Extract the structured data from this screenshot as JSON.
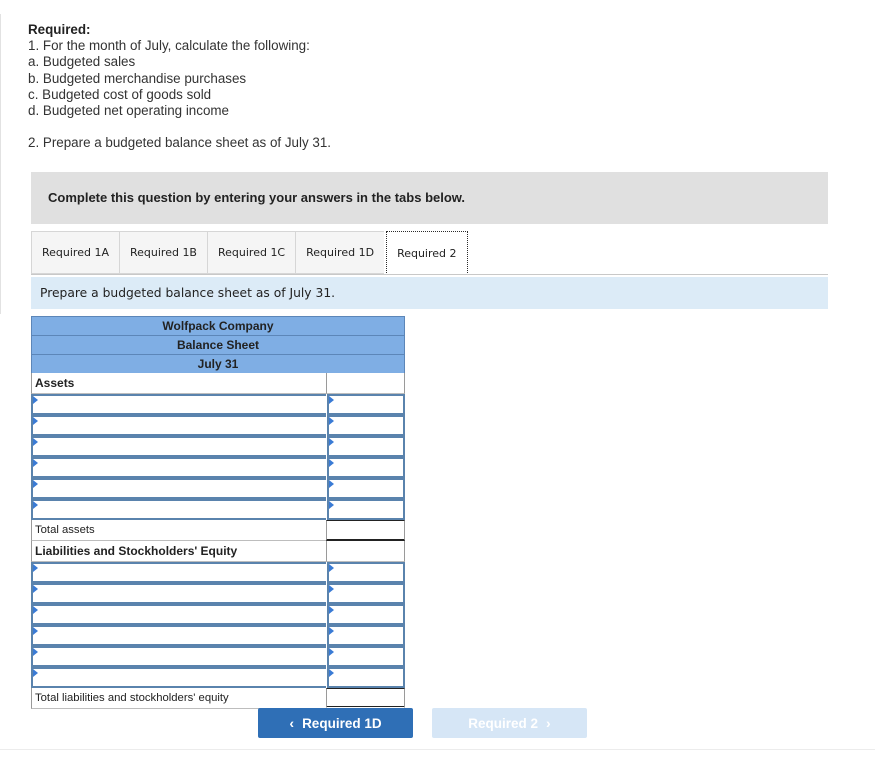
{
  "instructions": {
    "heading": "Required:",
    "lines": [
      "1. For the month of July, calculate the following:",
      "a. Budgeted sales",
      "b. Budgeted merchandise purchases",
      "c. Budgeted cost of goods sold",
      "d. Budgeted net operating income"
    ],
    "part2": "2. Prepare a budgeted balance sheet as of July 31."
  },
  "banner": "Complete this question by entering your answers in the tabs below.",
  "tabs": [
    "Required 1A",
    "Required 1B",
    "Required 1C",
    "Required 1D",
    "Required 2"
  ],
  "active_tab": "Required 2",
  "prompt": "Prepare a budgeted balance sheet as of July 31.",
  "sheet": {
    "company": "Wolfpack Company",
    "title": "Balance Sheet",
    "date": "July 31",
    "assets_label": "Assets",
    "total_assets_label": "Total assets",
    "liabilities_label": "Liabilities and Stockholders' Equity",
    "total_liabilities_label": "Total liabilities and stockholders' equity",
    "asset_rows": [
      "",
      "",
      "",
      "",
      "",
      ""
    ],
    "liability_rows": [
      "",
      "",
      "",
      "",
      "",
      ""
    ]
  },
  "nav": {
    "prev_label": "Required 1D",
    "next_label": "Required 2"
  },
  "colors": {
    "header_fill": "#7faee4",
    "input_border": "#5a83ad",
    "prompt_fill": "#dcebf7",
    "prev_button": "#2f6fb6",
    "next_button_disabled": "#d6e6f6"
  }
}
